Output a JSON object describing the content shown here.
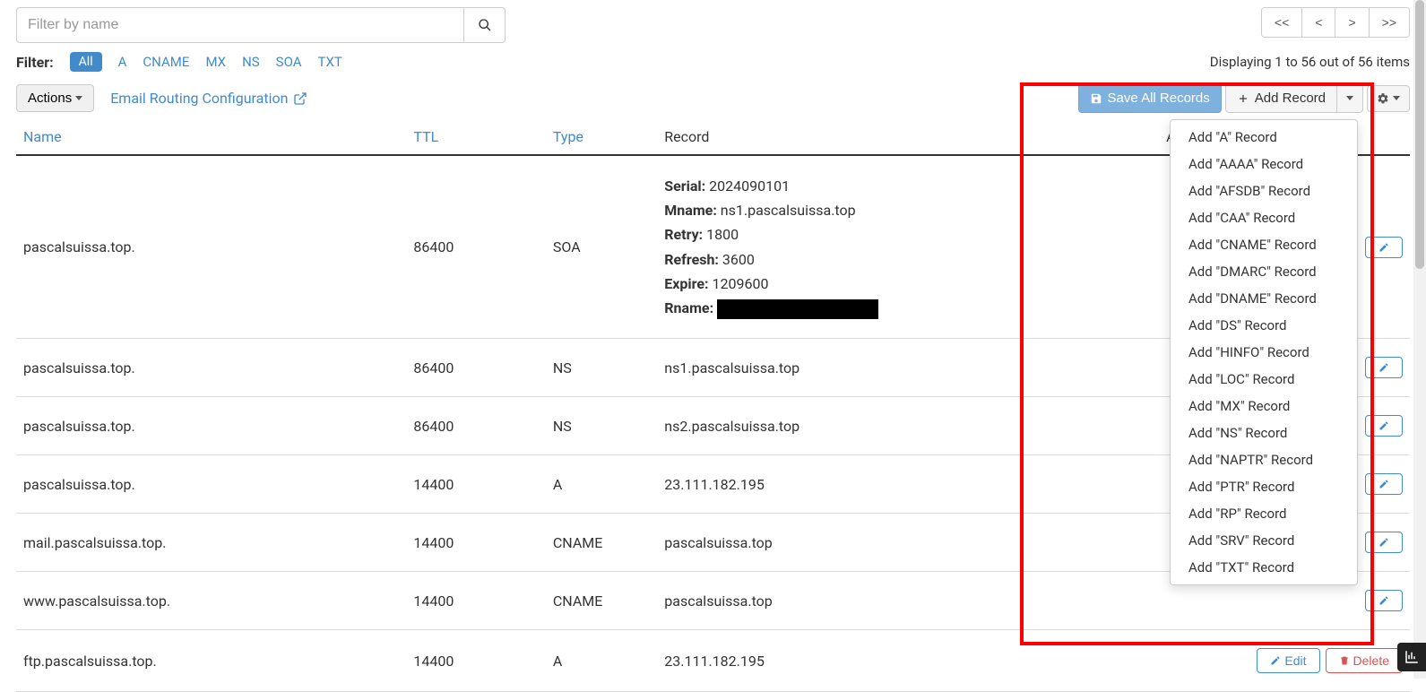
{
  "search": {
    "placeholder": "Filter by name"
  },
  "pager": {
    "first": "<<",
    "prev": "<",
    "next": ">",
    "last": ">>"
  },
  "filter": {
    "label": "Filter:",
    "all": "All",
    "types": [
      "A",
      "CNAME",
      "MX",
      "NS",
      "SOA",
      "TXT"
    ]
  },
  "display_count": "Displaying 1 to 56 out of 56 items",
  "actions": {
    "label": "Actions"
  },
  "email_routing": "Email Routing Configuration",
  "buttons": {
    "save_all": "Save All Records",
    "add_record": "Add Record",
    "edit": "Edit",
    "delete": "Delete"
  },
  "table": {
    "headers": {
      "name": "Name",
      "ttl": "TTL",
      "type": "Type",
      "record": "Record",
      "actions": "Actions"
    }
  },
  "soa": {
    "serial_label": "Serial:",
    "serial": "2024090101",
    "mname_label": "Mname:",
    "mname": "ns1.pascalsuissa.top",
    "retry_label": "Retry:",
    "retry": "1800",
    "refresh_label": "Refresh:",
    "refresh": "3600",
    "expire_label": "Expire:",
    "expire": "1209600",
    "rname_label": "Rname:"
  },
  "rows": [
    {
      "name": "pascalsuissa.top.",
      "ttl": "86400",
      "type": "SOA",
      "record": "__SOA__"
    },
    {
      "name": "pascalsuissa.top.",
      "ttl": "86400",
      "type": "NS",
      "record": "ns1.pascalsuissa.top"
    },
    {
      "name": "pascalsuissa.top.",
      "ttl": "86400",
      "type": "NS",
      "record": "ns2.pascalsuissa.top"
    },
    {
      "name": "pascalsuissa.top.",
      "ttl": "14400",
      "type": "A",
      "record": "23.111.182.195"
    },
    {
      "name": "mail.pascalsuissa.top.",
      "ttl": "14400",
      "type": "CNAME",
      "record": "pascalsuissa.top"
    },
    {
      "name": "www.pascalsuissa.top.",
      "ttl": "14400",
      "type": "CNAME",
      "record": "pascalsuissa.top"
    },
    {
      "name": "ftp.pascalsuissa.top.",
      "ttl": "14400",
      "type": "A",
      "record": "23.111.182.195"
    }
  ],
  "dropdown": [
    "Add \"A\" Record",
    "Add \"AAAA\" Record",
    "Add \"AFSDB\" Record",
    "Add \"CAA\" Record",
    "Add \"CNAME\" Record",
    "Add \"DMARC\" Record",
    "Add \"DNAME\" Record",
    "Add \"DS\" Record",
    "Add \"HINFO\" Record",
    "Add \"LOC\" Record",
    "Add \"MX\" Record",
    "Add \"NS\" Record",
    "Add \"NAPTR\" Record",
    "Add \"PTR\" Record",
    "Add \"RP\" Record",
    "Add \"SRV\" Record",
    "Add \"TXT\" Record"
  ]
}
